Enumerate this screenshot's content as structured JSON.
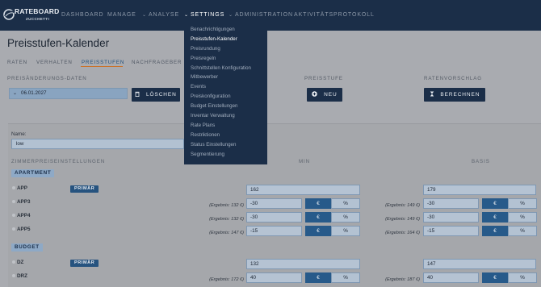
{
  "app": {
    "logo_title": "RATEBOARD",
    "logo_subtitle": "ZUCCHETTI",
    "brand_color": "#1b2e48",
    "accent_color": "#c9722a"
  },
  "nav": {
    "items": [
      {
        "label": "DASHBOARD",
        "has_dropdown": false
      },
      {
        "label": "MANAGE",
        "has_dropdown": false
      },
      {
        "label": "ANALYSE",
        "has_dropdown": true
      },
      {
        "label": "SETTINGS",
        "has_dropdown": true,
        "active": true
      },
      {
        "label": "ADMINISTRATION",
        "has_dropdown": true
      },
      {
        "label": "AKTIVITÄTSPROTOKOLL",
        "has_dropdown": false
      }
    ],
    "chevron": "⌄"
  },
  "settings_menu": {
    "items": [
      {
        "label": "Benachrichtigungen"
      },
      {
        "label": "Preisstufen-Kalender",
        "current": true
      },
      {
        "label": "Preisrundung"
      },
      {
        "label": "Preisregeln"
      },
      {
        "label": "Schnittstellen Konfiguration"
      },
      {
        "label": "Mitbewerber"
      },
      {
        "label": "Events"
      },
      {
        "label": "Preiskonfiguration"
      },
      {
        "label": "Budget Einstellungen"
      },
      {
        "label": "Inventar Verwaltung"
      },
      {
        "label": "Rate Plans"
      },
      {
        "label": "Restriktionen"
      },
      {
        "label": "Status Einstellungen"
      },
      {
        "label": "Segmentierung"
      }
    ]
  },
  "page": {
    "title": "Preisstufen-Kalender",
    "tabs": [
      {
        "label": "RATEN"
      },
      {
        "label": "VERHALTEN"
      },
      {
        "label": "PREISSTUFEN",
        "active": true
      },
      {
        "label": "NACHFRAGEBER"
      }
    ]
  },
  "controls": {
    "date_section_label": "PREISÄNDERUNGS-DATEN",
    "date_value": "06.01.2027",
    "delete_label": "LÖSCHEN",
    "delete_icon": "trash-icon",
    "price_level_label": "PREISSTUFE",
    "new_label": "NEU",
    "new_icon": "plus-circle-icon",
    "rate_suggestion_label": "RATENVORSCHLAG",
    "calculate_label": "BERECHNEN",
    "calculate_icon": "hourglass-icon"
  },
  "form": {
    "name_label": "Name:",
    "name_value": "low",
    "room_settings_label": "ZIMMERPREISEINSTELLUNGEN",
    "min_label": "MIN",
    "basis_label": "BASIS",
    "primary_badge": "PRIMÄR",
    "currency_symbol": "€",
    "percent_symbol": "%"
  },
  "groups": [
    {
      "name": "APARTMENT",
      "rooms": [
        {
          "name": "APP",
          "primary": true,
          "min_value": "162",
          "basis_value": "179"
        },
        {
          "name": "APP3",
          "min_value": "-30",
          "min_result": "(Ergebnis: 132 €)",
          "basis_value": "-30",
          "basis_result": "(Ergebnis: 149 €)"
        },
        {
          "name": "APP4",
          "min_value": "-30",
          "min_result": "(Ergebnis: 132 €)",
          "basis_value": "-30",
          "basis_result": "(Ergebnis: 149 €)"
        },
        {
          "name": "APP5",
          "min_value": "-15",
          "min_result": "(Ergebnis: 147 €)",
          "basis_value": "-15",
          "basis_result": "(Ergebnis: 164 €)"
        }
      ]
    },
    {
      "name": "BUDGET",
      "rooms": [
        {
          "name": "DZ",
          "primary": true,
          "min_value": "132",
          "basis_value": "147"
        },
        {
          "name": "DRZ",
          "min_value": "40",
          "min_result": "(Ergebnis: 172 €)",
          "basis_value": "40",
          "basis_result": "(Ergebnis: 187 €)"
        }
      ]
    }
  ]
}
